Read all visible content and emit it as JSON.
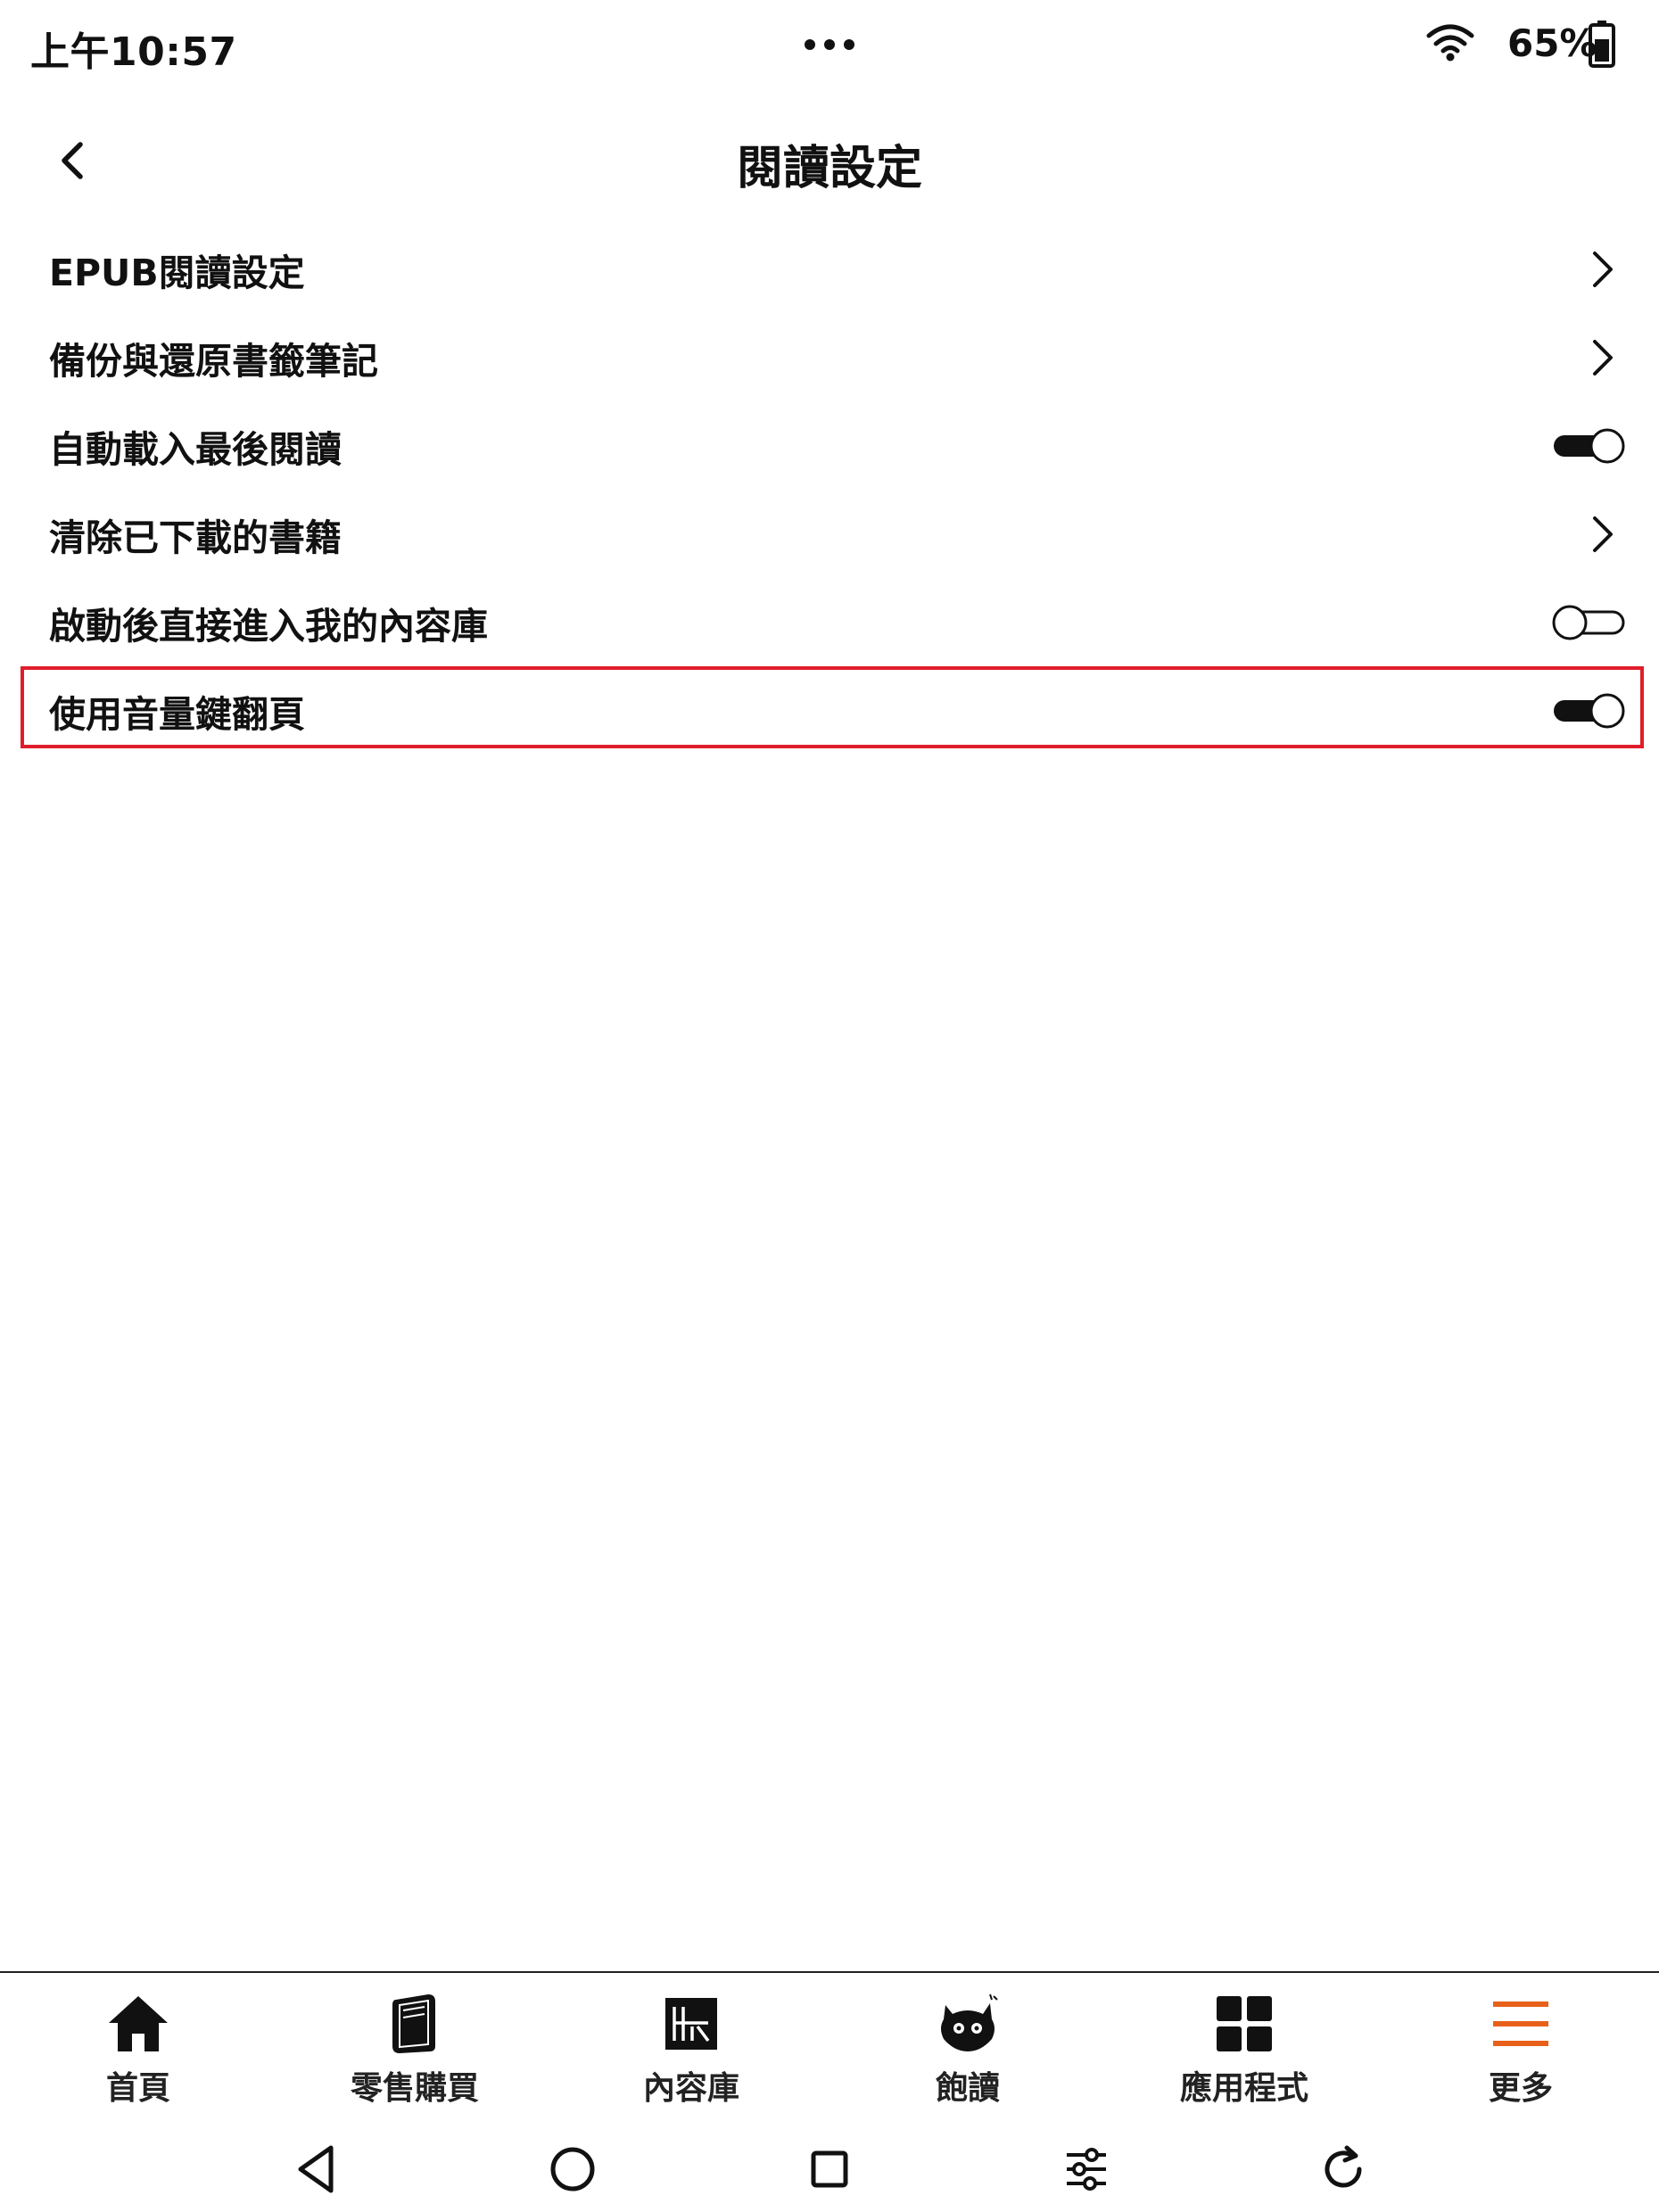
{
  "status_bar": {
    "time": "上午10:57",
    "battery": "65%",
    "icons": [
      "more-dots-icon",
      "wifi-icon",
      "battery-icon"
    ]
  },
  "header": {
    "title": "閱讀設定",
    "back_icon": "chevron-left-icon"
  },
  "settings": [
    {
      "label": "EPUB閱讀設定",
      "control": "chevron"
    },
    {
      "label": "備份與還原書籤筆記",
      "control": "chevron"
    },
    {
      "label": "自動載入最後閱讀",
      "control": "toggle",
      "on": true
    },
    {
      "label": "清除已下載的書籍",
      "control": "chevron"
    },
    {
      "label": "啟動後直接進入我的內容庫",
      "control": "toggle",
      "on": false
    },
    {
      "label": "使用音量鍵翻頁",
      "control": "toggle",
      "on": true,
      "highlighted": true
    }
  ],
  "bottom_nav": {
    "items": [
      {
        "label": "首頁",
        "icon": "home-icon"
      },
      {
        "label": "零售購買",
        "icon": "book-icon"
      },
      {
        "label": "內容庫",
        "icon": "library-icon"
      },
      {
        "label": "飽讀",
        "icon": "mascot-icon"
      },
      {
        "label": "應用程式",
        "icon": "apps-grid-icon"
      },
      {
        "label": "更多",
        "icon": "menu-icon"
      }
    ],
    "active_color": "#e8611a"
  },
  "system_nav": {
    "icons": [
      "back-triangle-icon",
      "home-circle-icon",
      "recents-square-icon",
      "settings-sliders-icon",
      "refresh-icon"
    ]
  },
  "colors": {
    "highlight": "#e01e2b",
    "text": "#111111",
    "accent": "#e8611a"
  }
}
